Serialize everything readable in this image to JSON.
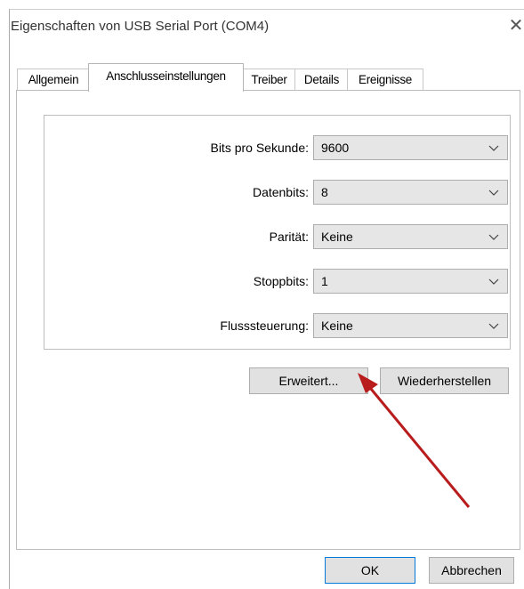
{
  "window": {
    "title": "Eigenschaften von USB Serial Port (COM4)",
    "close_icon": "close-icon"
  },
  "tabs": [
    {
      "label": "Allgemein",
      "active": false
    },
    {
      "label": "Anschlusseinstellungen",
      "active": true
    },
    {
      "label": "Treiber",
      "active": false
    },
    {
      "label": "Details",
      "active": false
    },
    {
      "label": "Ereignisse",
      "active": false
    }
  ],
  "settings": {
    "bits_label": "Bits pro Sekunde:",
    "bits_value": "9600",
    "data_label": "Datenbits:",
    "data_value": "8",
    "parity_label": "Parität:",
    "parity_value": "Keine",
    "stop_label": "Stoppbits:",
    "stop_value": "1",
    "flow_label": "Flusssteuerung:",
    "flow_value": "Keine"
  },
  "buttons": {
    "advanced": "Erweitert...",
    "restore": "Wiederherstellen",
    "ok": "OK",
    "cancel": "Abbrechen"
  },
  "colors": {
    "annotation_arrow": "#b81c1c",
    "accent": "#0078d7"
  }
}
